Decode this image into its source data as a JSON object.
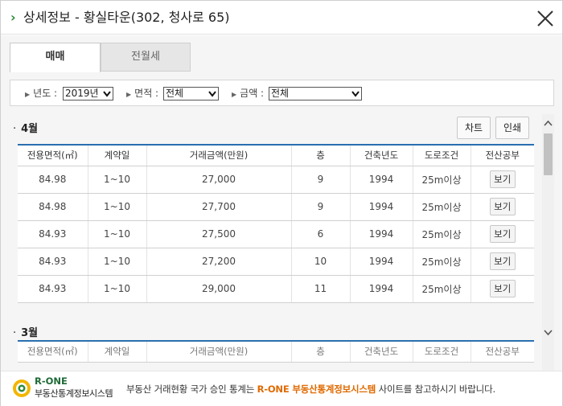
{
  "header": {
    "title": "상세정보 - 황실타운(302, 청사로 65)"
  },
  "tabs": [
    {
      "label": "매매",
      "active": true
    },
    {
      "label": "전월세",
      "active": false
    }
  ],
  "filters": {
    "year": {
      "label": "년도 :",
      "value": "2019년"
    },
    "area": {
      "label": "면적 :",
      "value": "전체"
    },
    "amount": {
      "label": "금액 :",
      "value": "전체"
    }
  },
  "actions": {
    "chart_label": "차트",
    "print_label": "인쇄"
  },
  "table_columns": [
    "전용면적(㎡)",
    "계약일",
    "거래금액(만원)",
    "층",
    "건축년도",
    "도로조건",
    "전산공부"
  ],
  "months": [
    {
      "label": "4월",
      "rows": [
        {
          "area": "84.98",
          "contract_day": "1~10",
          "price": "27,000",
          "floor": "9",
          "built_year": "1994",
          "road": "25m이상",
          "view": "보기"
        },
        {
          "area": "84.98",
          "contract_day": "1~10",
          "price": "27,700",
          "floor": "9",
          "built_year": "1994",
          "road": "25m이상",
          "view": "보기"
        },
        {
          "area": "84.93",
          "contract_day": "1~10",
          "price": "27,500",
          "floor": "6",
          "built_year": "1994",
          "road": "25m이상",
          "view": "보기"
        },
        {
          "area": "84.93",
          "contract_day": "1~10",
          "price": "27,200",
          "floor": "10",
          "built_year": "1994",
          "road": "25m이상",
          "view": "보기"
        },
        {
          "area": "84.93",
          "contract_day": "1~10",
          "price": "29,000",
          "floor": "11",
          "built_year": "1994",
          "road": "25m이상",
          "view": "보기"
        }
      ]
    },
    {
      "label": "3월",
      "rows": []
    }
  ],
  "footer": {
    "logo_title": "R-ONE",
    "logo_subtitle": "부동산통계정보시스템",
    "notice_prefix": "부동산 거래현황 국가 승인 통계는",
    "notice_highlight": "R-ONE 부동산통계정보시스템",
    "notice_suffix": "사이트를 참고하시기 바랍니다."
  },
  "colors": {
    "accent_green": "#2e8b3a",
    "table_header_line": "#2a6fb0",
    "highlight_orange": "#e06a00"
  }
}
